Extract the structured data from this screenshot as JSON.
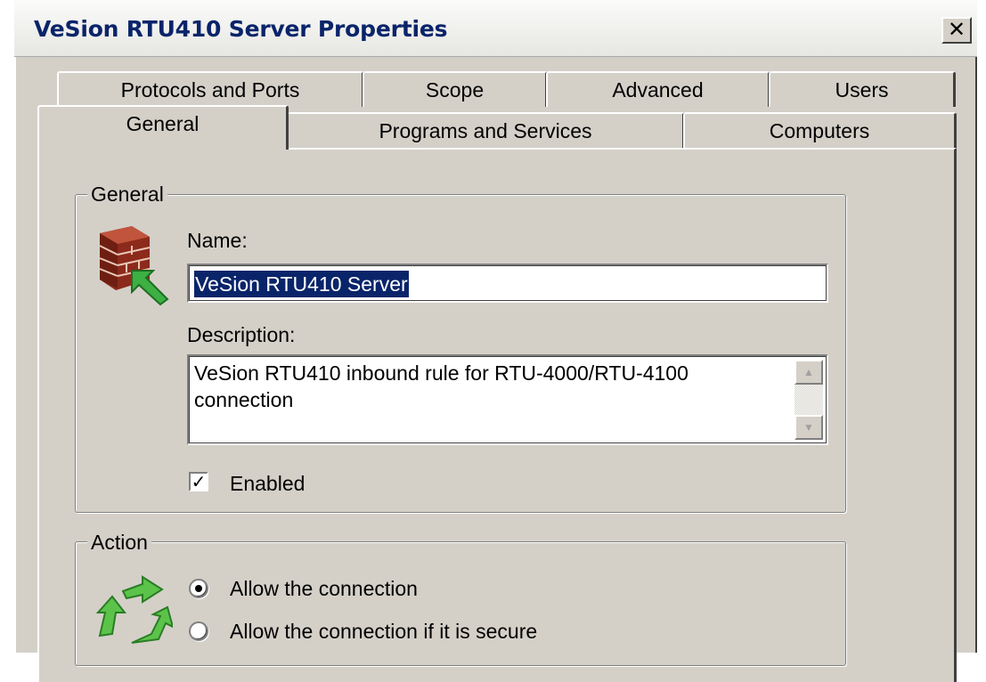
{
  "window": {
    "title": "VeSion RTU410 Server Properties",
    "close_glyph": "✕"
  },
  "tabs": {
    "row_back": [
      "Protocols and Ports",
      "Scope",
      "Advanced",
      "Users"
    ],
    "row_front": [
      "General",
      "Programs and Services",
      "Computers"
    ],
    "active": "General"
  },
  "general_group": {
    "label": "General",
    "icon": "firewall-brick-icon",
    "name_label": "Name:",
    "name_value": "VeSion RTU410 Server",
    "description_label": "Description:",
    "description_value": "VeSion RTU410 inbound rule for RTU-4000/RTU-4100 connection",
    "enabled_label": "Enabled",
    "enabled_checked": true
  },
  "action_group": {
    "label": "Action",
    "icon": "green-arrows-cycle-icon",
    "options": [
      {
        "label": "Allow the connection",
        "checked": true
      },
      {
        "label": "Allow the connection if it is secure",
        "checked": false
      }
    ]
  },
  "colors": {
    "dialog_face": "#d4d0c8",
    "title_text": "#0a246a",
    "selection": "#0a246a",
    "arrow_green": "#3cb043"
  }
}
